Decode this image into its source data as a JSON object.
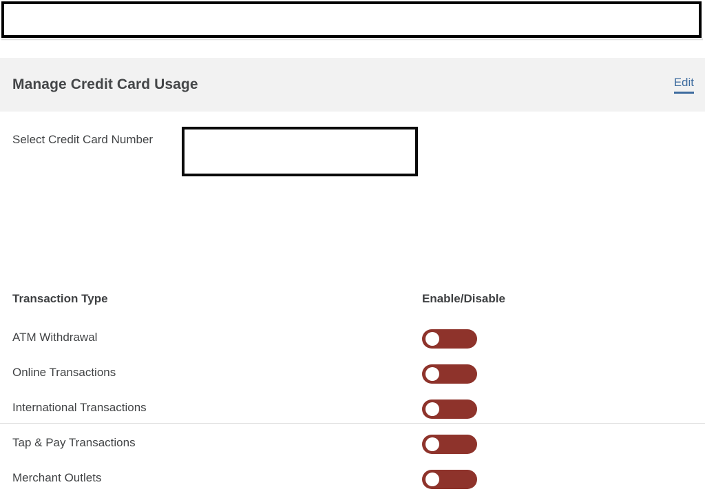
{
  "top_panel": {
    "name": "empty-framed-panel",
    "value": "",
    "placeholder": ""
  },
  "header": {
    "title": "Manage Credit Card Usage",
    "edit_label": "Edit",
    "accent_color": "#3d6b9e",
    "background_color": "#f2f2f2"
  },
  "form": {
    "select_card_label": "Select Credit Card Number",
    "select_card_value": "",
    "select_card_placeholder": ""
  },
  "table": {
    "columns": {
      "transaction_type": "Transaction Type",
      "enable_disable": "Enable/Disable"
    },
    "toggle_color": "#8e332b",
    "knob_color": "#ffffff",
    "rows": [
      {
        "label": "ATM Withdrawal",
        "state": "off"
      },
      {
        "label": "Online Transactions",
        "state": "off"
      },
      {
        "label": "International Transactions",
        "state": "off"
      },
      {
        "label": "Tap & Pay Transactions",
        "state": "off"
      },
      {
        "label": "Merchant Outlets",
        "state": "off"
      }
    ]
  }
}
